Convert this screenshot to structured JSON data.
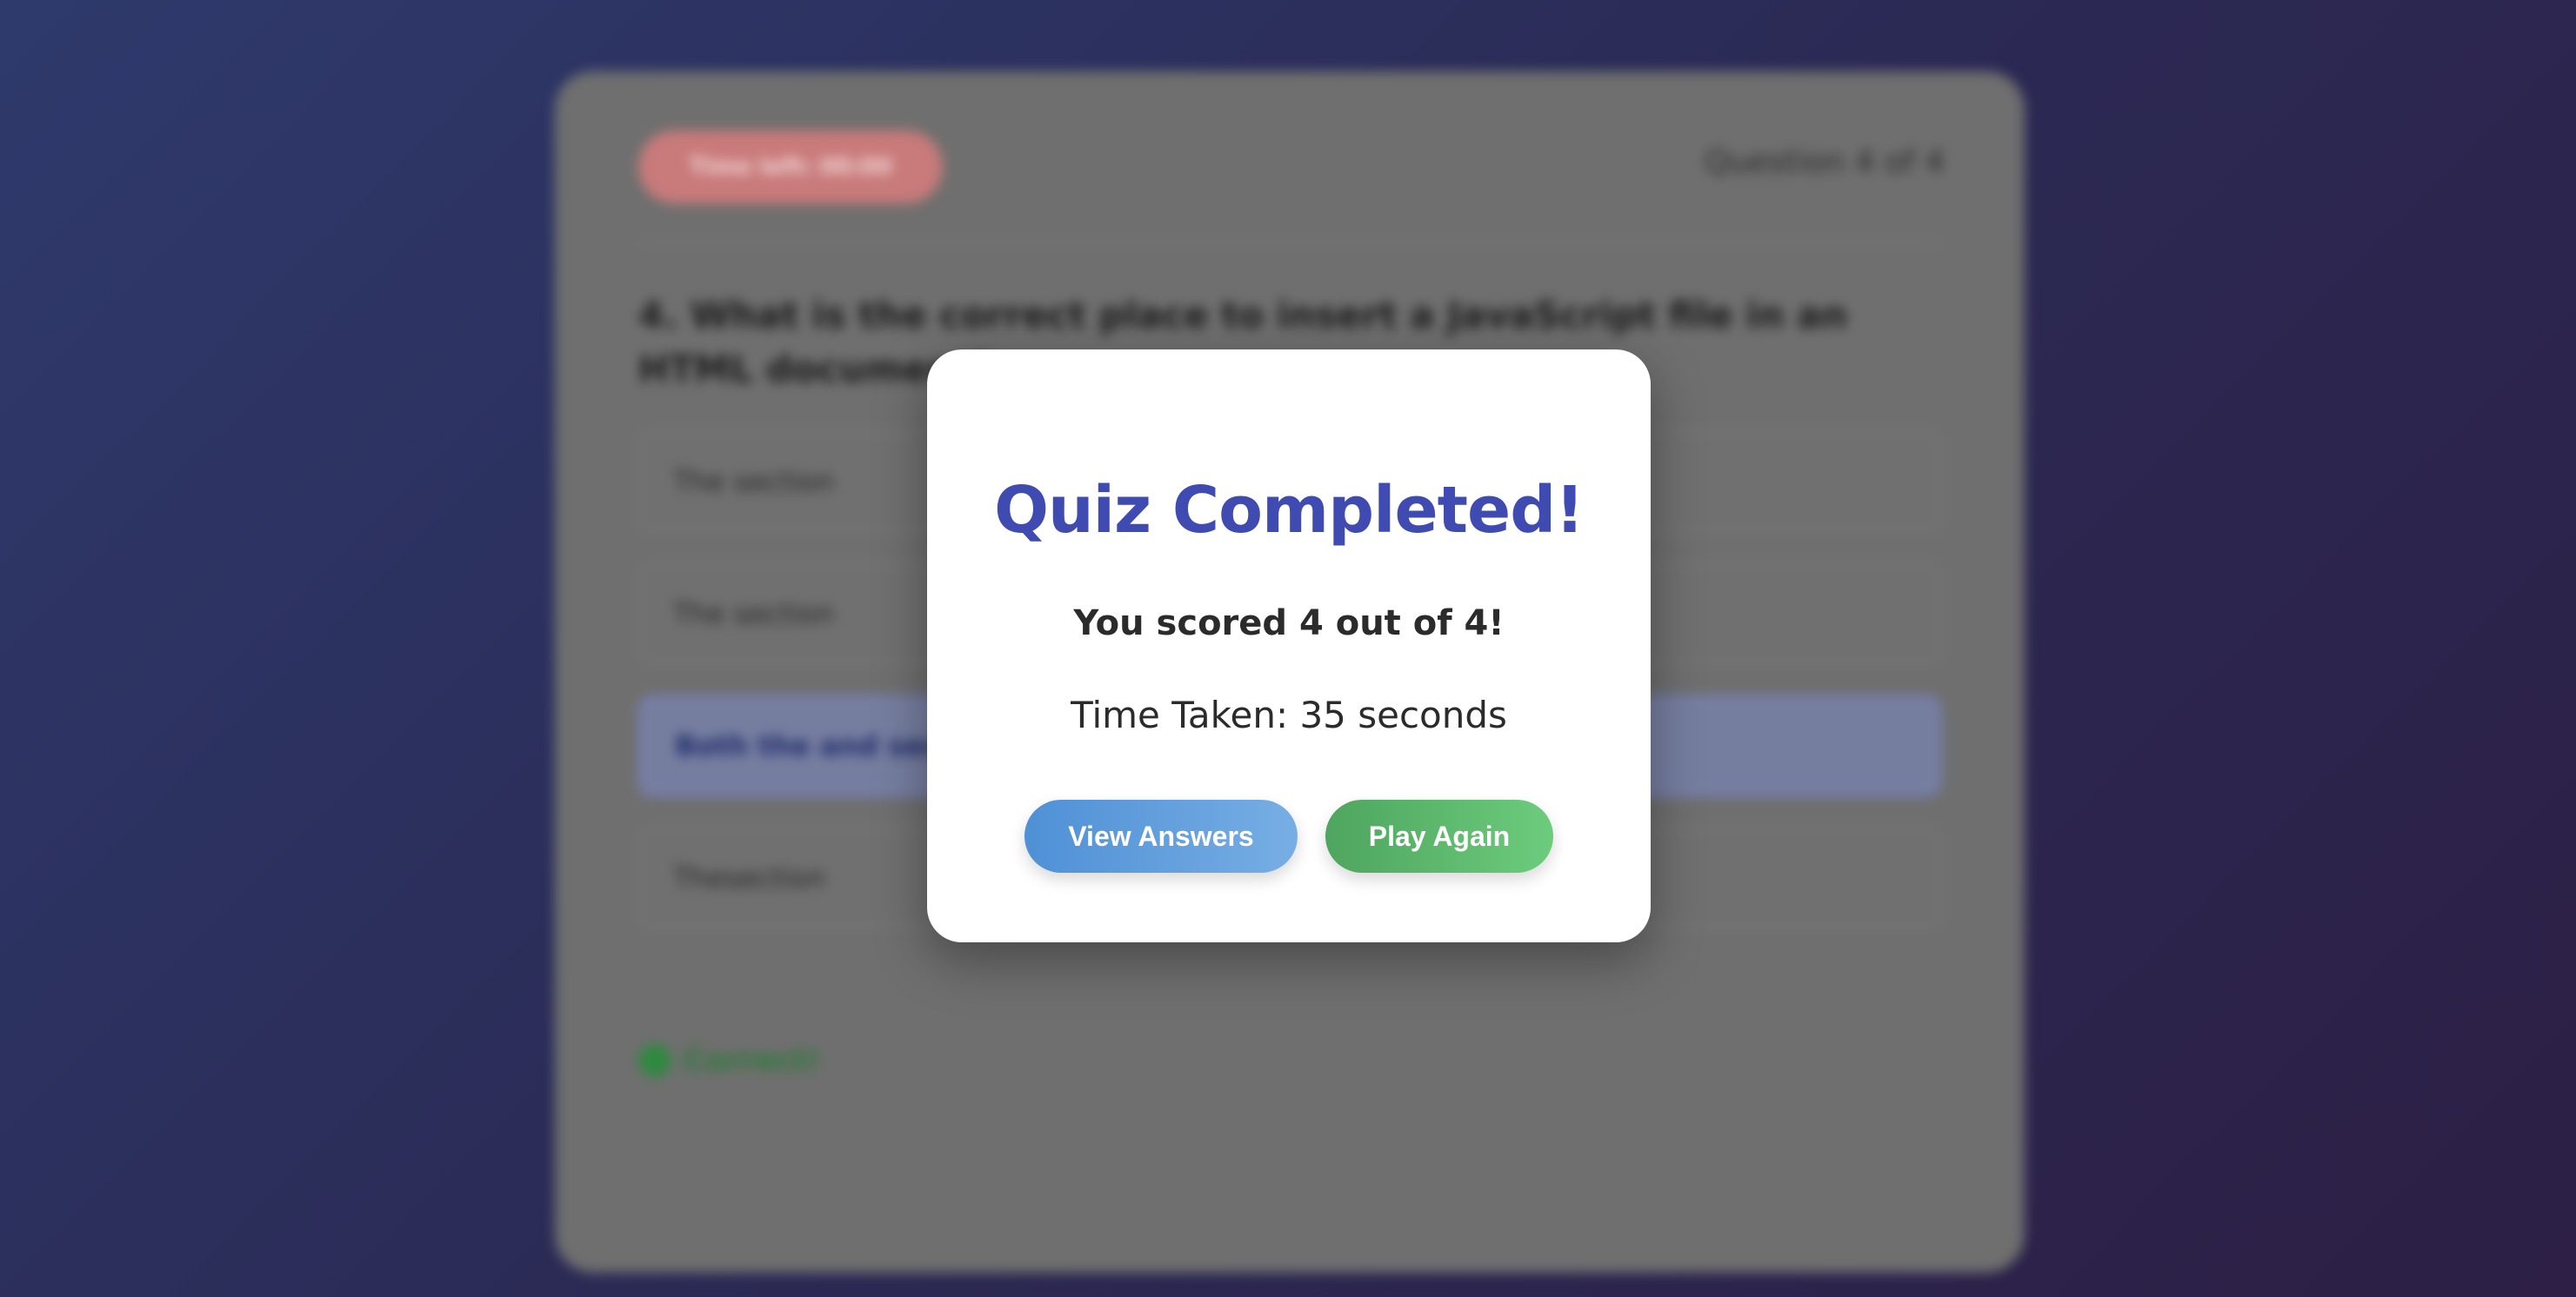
{
  "background_quiz": {
    "timer_label": "Time left: 00:00",
    "question_counter": "Question 4 of 4",
    "question": "4. What is the correct place to insert a JavaScript file in an HTML document?",
    "options": [
      {
        "label": "The section"
      },
      {
        "label": "The section"
      },
      {
        "label": "Both the and section"
      },
      {
        "label": "Thesection"
      }
    ],
    "selected_option_index": 2,
    "feedback": "Correct!"
  },
  "modal": {
    "title": "Quiz Completed!",
    "score_text": "You scored 4 out of 4!",
    "time_text": "Time Taken: 35 seconds",
    "view_answers_label": "View Answers",
    "play_again_label": "Play Again"
  },
  "colors": {
    "title": "#3f4bb0",
    "view_button": "#4f90d6",
    "play_button": "#4ea55f",
    "timer_pill": "#c97a7a",
    "background_start": "#2e3a6c",
    "background_end": "#2d1f45"
  }
}
